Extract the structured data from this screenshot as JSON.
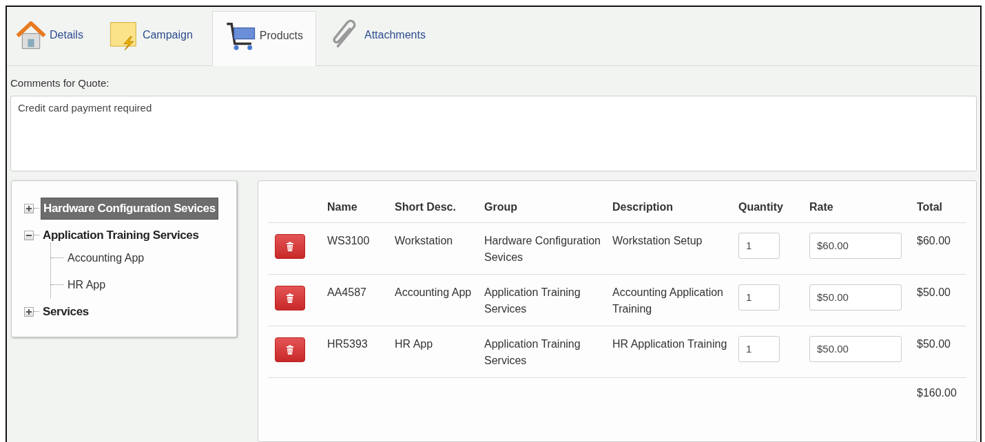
{
  "tabs": [
    {
      "label": "Details",
      "kind": "house",
      "selected": false
    },
    {
      "label": "Campaign",
      "kind": "note",
      "selected": false
    },
    {
      "label": "Products",
      "kind": "cart",
      "selected": true
    },
    {
      "label": "Attachments",
      "kind": "clip",
      "selected": false
    }
  ],
  "comments": {
    "label": "Comments for Quote:",
    "value": "Credit card payment required"
  },
  "tree": [
    {
      "label": "Hardware Configuration Sevices",
      "expanded": false,
      "selected": true
    },
    {
      "label": "Application Training Services",
      "expanded": true,
      "selected": false,
      "children": [
        {
          "label": "Accounting App",
          "selected": false
        },
        {
          "label": "HR App",
          "selected": false
        }
      ]
    },
    {
      "label": "Services",
      "expanded": false,
      "selected": false
    }
  ],
  "table": {
    "columns": [
      "Name",
      "Short Desc.",
      "Group",
      "Description",
      "Quantity",
      "Rate",
      "Total"
    ],
    "rows": [
      {
        "name": "WS3100",
        "short_desc": "Workstation",
        "group": "Hardware Configuration Sevices",
        "description": "Workstation Setup",
        "quantity": "1",
        "rate": "$60.00",
        "total": "$60.00"
      },
      {
        "name": "AA4587",
        "short_desc": "Accounting App",
        "group": "Application Training Services",
        "description": "Accounting Application Training",
        "quantity": "1",
        "rate": "$50.00",
        "total": "$50.00"
      },
      {
        "name": "HR5393",
        "short_desc": "HR App",
        "group": "Application Training Services",
        "description": "HR Application Training",
        "quantity": "1",
        "rate": "$50.00",
        "total": "$50.00"
      }
    ],
    "grand_total": "$160.00"
  }
}
